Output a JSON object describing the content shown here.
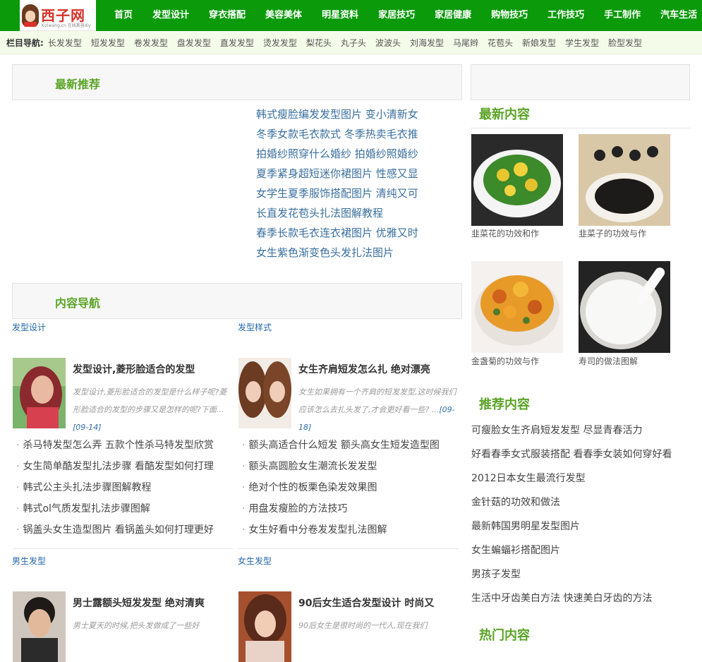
{
  "site": {
    "name": "西子网",
    "url": "Xiziwang.cn 在线美容diy"
  },
  "nav": [
    "首页",
    "发型设计",
    "穿衣搭配",
    "美容美体",
    "明星资料",
    "家居技巧",
    "家居健康",
    "购物技巧",
    "工作技巧",
    "手工制作",
    "汽车生活"
  ],
  "subnav": {
    "label": "栏目导航:",
    "items": [
      "长发发型",
      "短发发型",
      "卷发发型",
      "盘发发型",
      "直发发型",
      "烫发发型",
      "梨花头",
      "丸子头",
      "波波头",
      "刘海发型",
      "马尾辫",
      "花苞头",
      "新娘发型",
      "学生发型",
      "脸型发型"
    ]
  },
  "recommend": {
    "title": "最新推荐",
    "items": [
      "韩式瘦脸编发发型图片 变小清新女",
      "冬季女款毛衣款式 冬季热卖毛衣推",
      "拍婚纱照穿什么婚纱 拍婚纱照婚纱",
      "夏季紧身超短迷你裙图片 性感又显",
      "女学生夏季服饰搭配图片 清纯又可",
      "长直发花苞头扎法图解教程",
      "春季长款毛衣连衣裙图片 优雅又时",
      "女生紫色渐变色头发扎法图片"
    ]
  },
  "content_nav": {
    "title": "内容导航"
  },
  "sections": [
    {
      "label": "发型设计",
      "feature": {
        "title": "发型设计,菱形脸适合的发型",
        "desc": "发型设计,菱形脸适合的发型是什么样子呢?菱形脸适合的发型的步骤又是怎样的呢?下面...",
        "date": "[09-14]"
      },
      "links": [
        "杀马特发型怎么弄 五款个性杀马特发型欣赏",
        "女生简单酷发型扎法步骤 看酷发型如何打理",
        "韩式公主头扎法步骤图解教程",
        "韩式ol气质发型扎法步骤图解",
        "锅盖头女生造型图片 看锅盖头如何打理更好"
      ]
    },
    {
      "label": "发型样式",
      "feature": {
        "title": "女生齐肩短发怎么扎 绝对漂亮",
        "desc": "女生如果拥有一个齐肩的短发发型,这时候我们应该怎么去扎头发了,才会更好看一些? ...",
        "date": "[09-18]"
      },
      "links": [
        "额头高适合什么短发 额头高女生短发造型图",
        "额头高圆脸女生潮流长发发型",
        "绝对个性的板栗色染发效果图",
        "用盘发瘦脸的方法技巧",
        "女生好看中分卷发发型扎法图解"
      ]
    },
    {
      "label": "男生发型",
      "feature": {
        "title": "男士露额头短发发型 绝对清爽",
        "desc": "男士夏天的时候,把头发做成了一些好"
      }
    },
    {
      "label": "女生发型",
      "feature": {
        "title": "90后女生适合发型设计 时尚又",
        "desc": "90后女生是很时尚的一代人,现在我们"
      }
    }
  ],
  "latest": {
    "title": "最新内容",
    "items": [
      "韭菜花的功效和作",
      "韭菜子的功效与作",
      "金盏菊的功效与作",
      "寿司的做法图解"
    ]
  },
  "recommended": {
    "title": "推荐内容",
    "items": [
      "可瘦脸女生齐肩短发发型 尽显青春活力",
      "好看春季女式服装搭配 看春季女装如何穿好看",
      "2012日本女生最流行发型",
      "金针菇的功效和做法",
      "最新韩国男明星发型图片",
      "女生蝙蝠衫搭配图片",
      "男孩子发型",
      "生活中牙齿美白方法 快速美白牙齿的方法"
    ]
  },
  "hot": {
    "title": "热门内容"
  },
  "colors": {
    "nav_bg": "#0a9a0a",
    "accent_green": "#5aa425",
    "link_blue": "#3a6f9e"
  }
}
